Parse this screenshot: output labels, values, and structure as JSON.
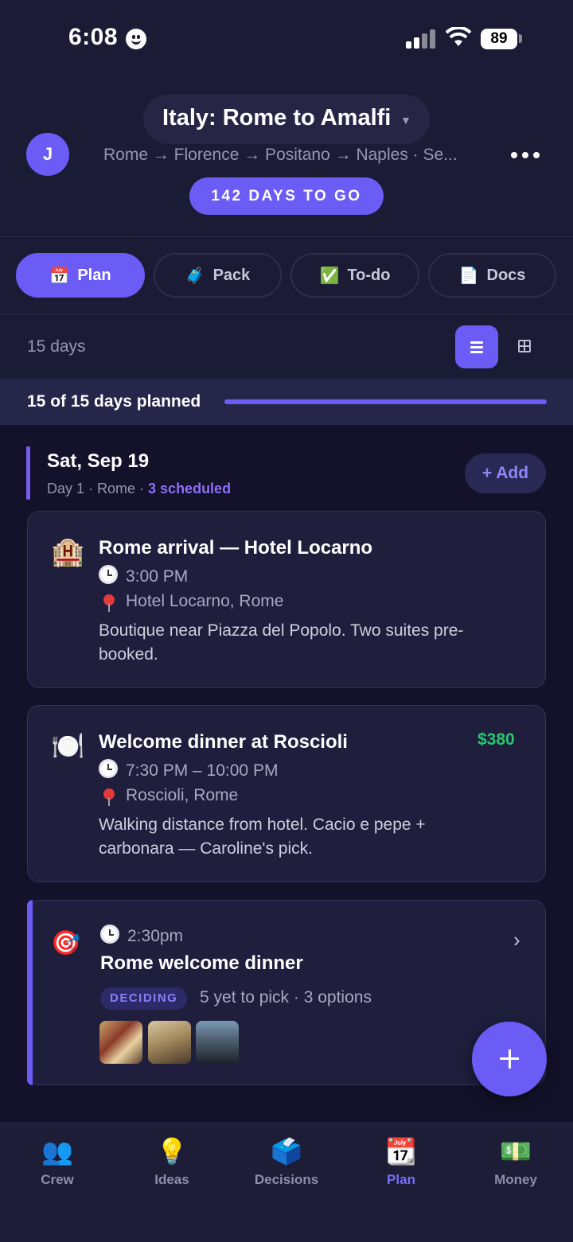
{
  "status_bar": {
    "time": "6:08",
    "battery": "89"
  },
  "header": {
    "trip_title": "Italy: Rome to Amalfi",
    "avatar_initial": "J",
    "route": "Rome → Florence → Positano → Naples · Se...",
    "countdown": "142 DAYS TO GO"
  },
  "tabs": [
    {
      "icon": "📅",
      "label": "Plan",
      "active": true
    },
    {
      "icon": "🧳",
      "label": "Pack",
      "active": false
    },
    {
      "icon": "✅",
      "label": "To-do",
      "active": false
    },
    {
      "icon": "📄",
      "label": "Docs",
      "active": false
    }
  ],
  "days": {
    "count_label": "15 days"
  },
  "progress": {
    "label": "15 of 15 days planned",
    "fraction": 1.0
  },
  "day": {
    "title": "Sat, Sep 19",
    "subtitle": "Day 1 · Rome · ",
    "scheduled": "3 scheduled",
    "add_label": "+ Add"
  },
  "events": [
    {
      "icon": "🏨",
      "title": "Rome arrival — Hotel Locarno",
      "time": "3:00 PM",
      "location": "Hotel Locarno, Rome",
      "description": "Boutique near Piazza del Popolo. Two suites pre-booked."
    },
    {
      "icon": "🍽️",
      "title": "Welcome dinner at Roscioli",
      "price": "$380",
      "time": "7:30 PM – 10:00 PM",
      "location": "Roscioli, Rome",
      "description": "Walking distance from hotel. Cacio e pepe + carbonara — Caroline's pick."
    }
  ],
  "decision": {
    "icon": "🎯",
    "time": "2:30pm",
    "title": "Rome welcome dinner",
    "badge": "DECIDING",
    "status": "5 yet to pick · 3 options"
  },
  "nav": [
    {
      "icon": "👥",
      "label": "Crew",
      "active": false
    },
    {
      "icon": "💡",
      "label": "Ideas",
      "active": false
    },
    {
      "icon": "🗳️",
      "label": "Decisions",
      "active": false
    },
    {
      "icon": "📆",
      "label": "Plan",
      "active": true
    },
    {
      "icon": "💵",
      "label": "Money",
      "active": false
    }
  ],
  "colors": {
    "accent": "#6b5cf6",
    "price": "#28c76f",
    "background": "#1c1b35"
  }
}
